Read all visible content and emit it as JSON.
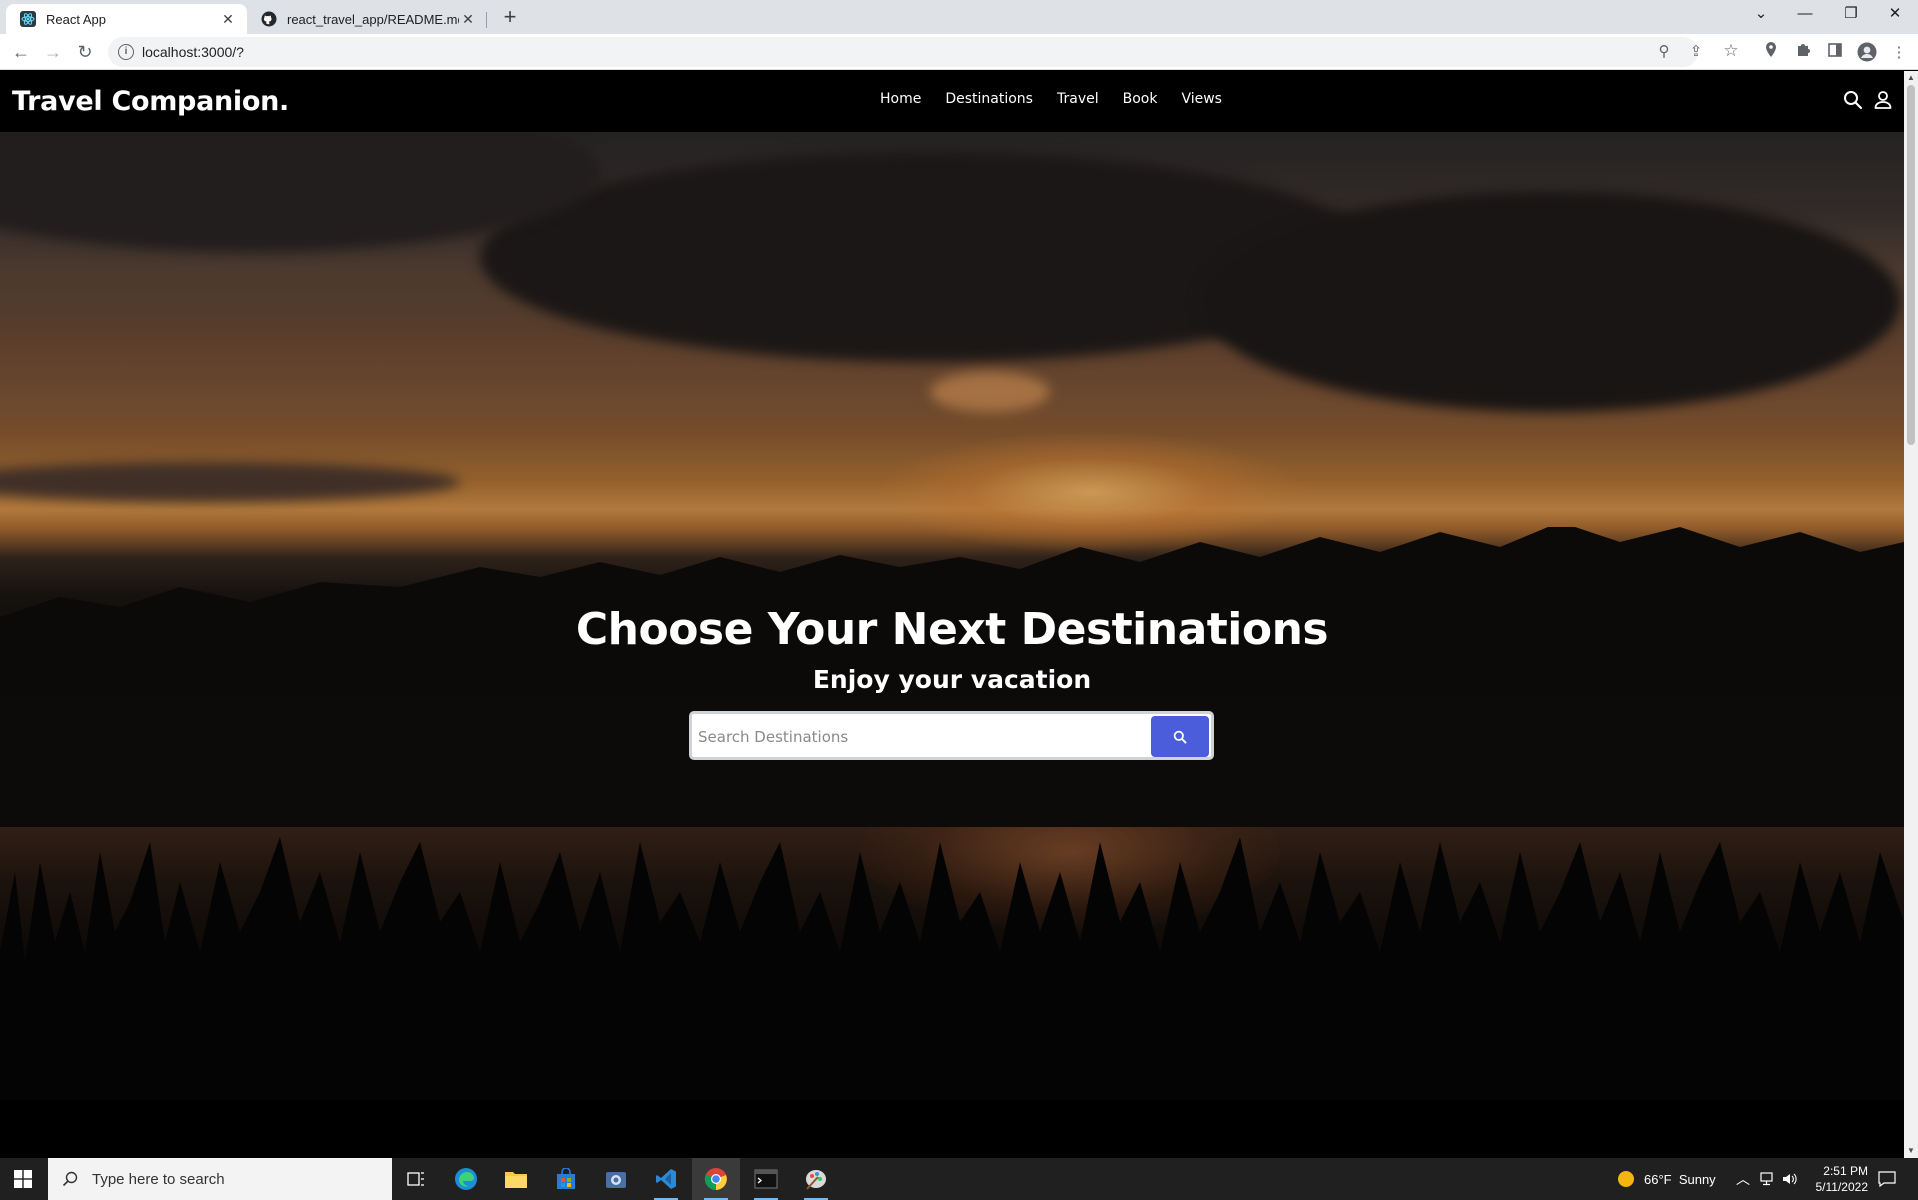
{
  "browser": {
    "tabs": [
      {
        "title": "React App",
        "active": true
      },
      {
        "title": "react_travel_app/README.md at",
        "active": false
      }
    ],
    "url": "localhost:3000/?"
  },
  "site": {
    "brand": "Travel Companion.",
    "nav": [
      "Home",
      "Destinations",
      "Travel",
      "Book",
      "Views"
    ],
    "hero_title": "Choose Your Next Destinations",
    "hero_subtitle": "Enjoy your vacation",
    "search_placeholder": "Search Destinations",
    "accent_color": "#4b5ddb"
  },
  "taskbar": {
    "search_text": "Type here to search",
    "weather": "66°F  Sunny",
    "time": "2:51 PM",
    "date": "5/11/2022"
  }
}
